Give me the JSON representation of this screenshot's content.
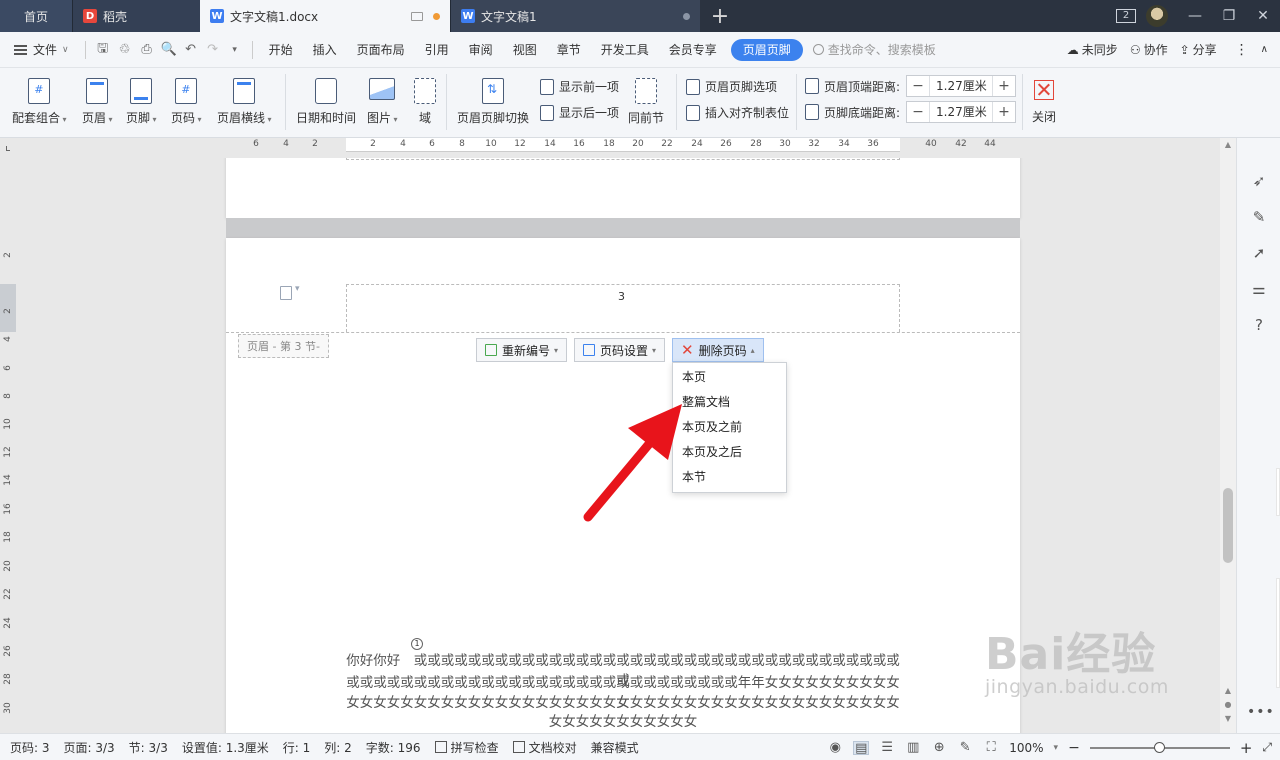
{
  "tabs": {
    "home": "首页",
    "daoke": "稻壳",
    "doc1": "文字文稿1.docx",
    "doc2": "文字文稿1"
  },
  "window": {
    "badge": "2"
  },
  "menu": {
    "file": "文件",
    "items": [
      "开始",
      "插入",
      "页面布局",
      "引用",
      "审阅",
      "视图",
      "章节",
      "开发工具",
      "会员专享"
    ],
    "active": "页眉页脚",
    "search_placeholder": "查找命令、搜索模板",
    "sync": "未同步",
    "collab": "协作",
    "share": "分享"
  },
  "ribbon": {
    "combo": "配套组合",
    "header": "页眉",
    "footer": "页脚",
    "page_num": "页码",
    "header_line": "页眉横线",
    "datetime": "日期和时间",
    "picture": "图片",
    "field": "域",
    "switch": "页眉页脚切换",
    "show_prev": "显示前一项",
    "show_next": "显示后一项",
    "same_prev": "同前节",
    "hf_options": "页眉页脚选项",
    "insert_tab": "插入对齐制表位",
    "top_dist_label": "页眉顶端距离:",
    "top_dist_value": "1.27厘米",
    "bottom_dist_label": "页脚底端距离:",
    "bottom_dist_value": "1.27厘米",
    "close": "关闭"
  },
  "ruler": {
    "h_ticks": [
      "6",
      "4",
      "2",
      "2",
      "4",
      "6",
      "8",
      "10",
      "12",
      "14",
      "16",
      "18",
      "20",
      "22",
      "24",
      "26",
      "28",
      "30",
      "32",
      "34",
      "36",
      "40",
      "42",
      "44"
    ],
    "v_ticks": [
      "2",
      "2",
      "4",
      "6",
      "8",
      "10",
      "12",
      "14",
      "16",
      "18",
      "20",
      "22",
      "24",
      "26",
      "28",
      "30"
    ]
  },
  "document": {
    "page_number": "3",
    "header_label": "页眉 - 第 3 节-",
    "float_buttons": {
      "renumber": "重新编号",
      "page_settings": "页码设置",
      "delete_page_num": "删除页码"
    },
    "delete_menu": [
      "本页",
      "整篇文档",
      "本页及之前",
      "本页及之后",
      "本节"
    ],
    "footnote_mark": "1",
    "body_lines": [
      "你好你好　或或或或或或或或或或或或或或或或或或或或或或或或或或或或或或或或或或或或或",
      "或或或或或或或或或或或或或或或或或或或或或或或或或或或或或年年女女女女女女女女女女女",
      "女女女女女女女女女女女女女女女女女女女女女女女女女女女女女女女女女女女女女女女女女",
      "女女女女女女女女女女女"
    ]
  },
  "status": {
    "page": "页码: 3",
    "pages": "页面: 3/3",
    "section": "节: 3/3",
    "setting": "设置值: 1.3厘米",
    "row": "行: 1",
    "col": "列: 2",
    "words": "字数: 196",
    "spell": "拼写检查",
    "proof": "文档校对",
    "compat": "兼容模式",
    "zoom": "100%"
  },
  "watermark": {
    "brand": "Bai经验",
    "url": "jingyan.baidu.com"
  },
  "colors": {
    "accent": "#3c82ee",
    "tabbar": "#2b3340",
    "arrow": "#e8141b"
  }
}
